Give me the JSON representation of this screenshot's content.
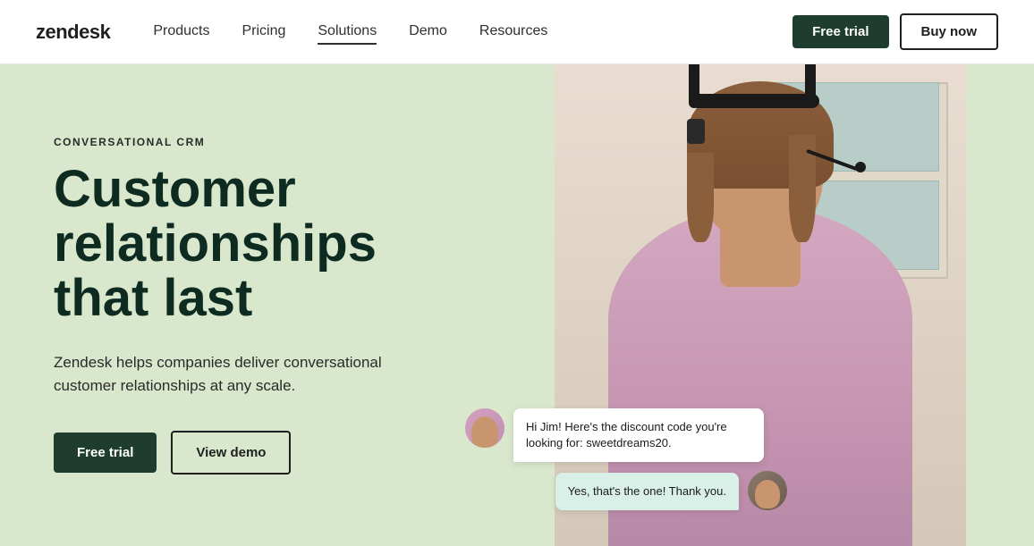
{
  "header": {
    "logo": "zendesk",
    "nav": [
      {
        "label": "Products",
        "active": false
      },
      {
        "label": "Pricing",
        "active": false
      },
      {
        "label": "Solutions",
        "active": true
      },
      {
        "label": "Demo",
        "active": false
      },
      {
        "label": "Resources",
        "active": false
      }
    ],
    "free_trial_label": "Free trial",
    "buy_now_label": "Buy now"
  },
  "hero": {
    "eyebrow": "CONVERSATIONAL CRM",
    "title_line1": "Customer",
    "title_line2": "relationships",
    "title_line3": "that last",
    "subtitle": "Zendesk helps companies deliver conversational customer relationships at any scale.",
    "btn_trial": "Free trial",
    "btn_demo": "View demo",
    "chat_bubble_agent": "Hi Jim! Here's the discount code you're looking for: sweetdreams20.",
    "chat_bubble_customer": "Yes, that's the one! Thank you."
  }
}
